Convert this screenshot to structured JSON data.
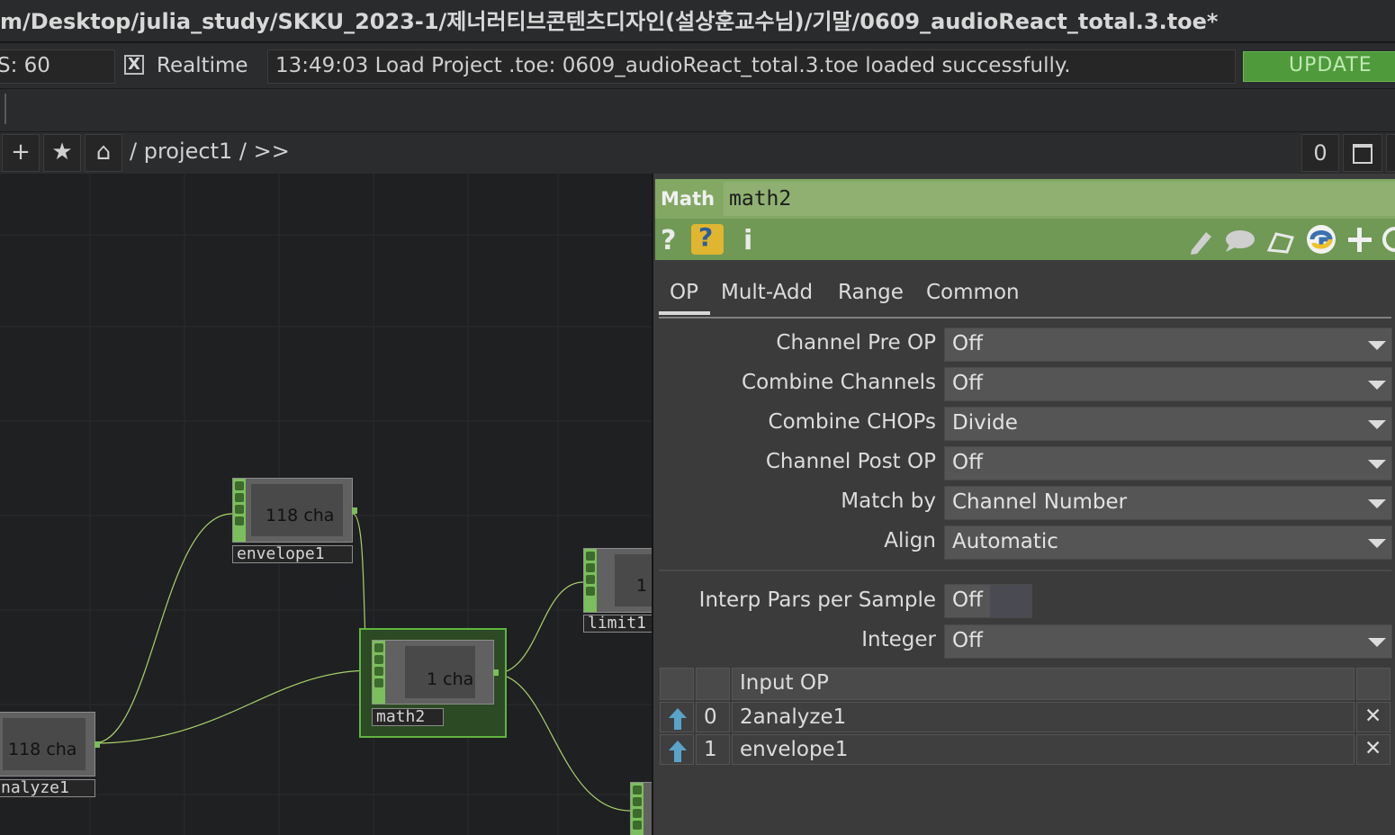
{
  "title_bar": {
    "path": "m/Desktop/julia_study/SKKU_2023-1/제너러티브콘텐츠디자인(설상훈교수님)/기말/0609_audioReact_total.3.toe*"
  },
  "toolbar": {
    "fps_text": "S:  60",
    "realtime_check": "X",
    "realtime_label": "Realtime",
    "status_message": "13:49:03 Load Project .toe: 0609_audioReact_total.3.toe loaded successfully.",
    "update_label": "UPDATE"
  },
  "pathbar": {
    "add_symbol": "+",
    "star_symbol": "★",
    "home_symbol": "⌂",
    "path": "/ project1 / >>",
    "counter": "0"
  },
  "network": {
    "nodes": [
      {
        "name": "envelope1",
        "count": "118",
        "unit": "cha"
      },
      {
        "name": "math2",
        "count": "1",
        "unit": "cha"
      },
      {
        "name": "limit1",
        "count": "1",
        "unit": ""
      },
      {
        "name": "nalyze1",
        "count": "118",
        "unit": "cha"
      }
    ]
  },
  "panel": {
    "op_type": "Math",
    "op_name": "math2",
    "help_symbol": "?",
    "info_symbol": "i",
    "tabs": [
      "OP",
      "Mult-Add",
      "Range",
      "Common"
    ],
    "params": [
      {
        "label": "Channel Pre OP",
        "value": "Off"
      },
      {
        "label": "Combine Channels",
        "value": "Off"
      },
      {
        "label": "Combine CHOPs",
        "value": "Divide"
      },
      {
        "label": "Channel Post OP",
        "value": "Off"
      },
      {
        "label": "Match by",
        "value": "Channel Number"
      },
      {
        "label": "Align",
        "value": "Automatic"
      }
    ],
    "interp": {
      "label": "Interp Pars per Sample",
      "value": "Off"
    },
    "integer": {
      "label": "Integer",
      "value": "Off"
    },
    "input_table": {
      "header": "Input OP",
      "rows": [
        {
          "index": "0",
          "op": "2analyze1"
        },
        {
          "index": "1",
          "op": "envelope1"
        }
      ]
    }
  },
  "colors": {
    "accent_green": "#83a864",
    "update_green": "#4f9a3a",
    "delete_red": "#e0363d"
  }
}
